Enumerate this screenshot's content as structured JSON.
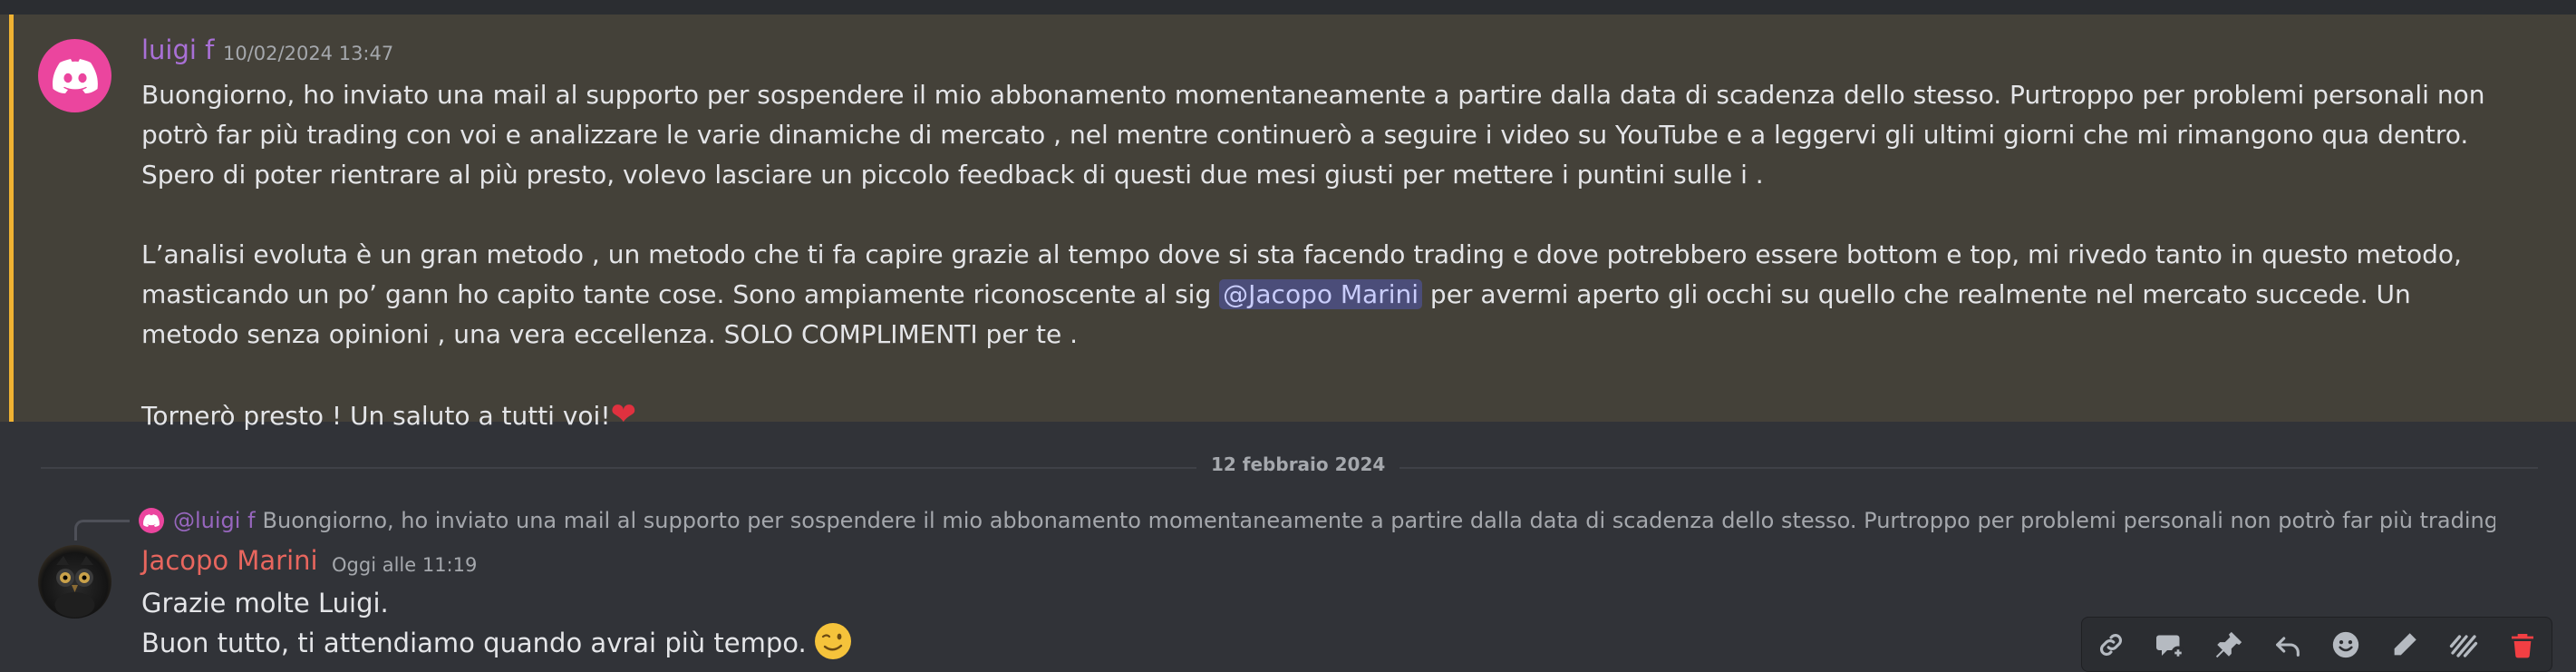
{
  "message1": {
    "author": "luigi f",
    "timestamp": "10/02/2024 13:47",
    "highlight_color": "#f0b232",
    "author_color": "#a970d6",
    "paragraph1": "Buongiorno, ho inviato una mail al supporto per sospendere il mio abbonamento momentaneamente a partire dalla data di scadenza dello stesso. Purtroppo per problemi personali non potrò far più trading con voi e analizzare le varie dinamiche di mercato , nel mentre continuerò a seguire i video su YouTube e a leggervi gli ultimi giorni che mi rimangono qua dentro. Spero di poter rientrare al più presto, volevo lasciare un piccolo feedback di questi due mesi giusti per mettere i puntini sulle i .",
    "paragraph2_before": "L’analisi evoluta è un gran metodo , un metodo che ti fa capire grazie al tempo dove si sta facendo trading e dove potrebbero essere bottom e top, mi rivedo tanto in questo metodo, masticando un po’ gann ho capito tante cose. Sono ampiamente riconoscente al sig ",
    "mention": "@Jacopo Marini",
    "paragraph2_after": " per avermi aperto gli occhi su quello che realmente nel mercato succede. Un metodo senza opinioni , una vera eccellenza. SOLO COMPLIMENTI per te .",
    "paragraph3": "Tornerò presto ! Un saluto a tutti voi!",
    "emoji": "heart"
  },
  "date_divider": "12 febbraio 2024",
  "message2": {
    "reply_author": "@luigi f",
    "reply_preview": "Buongiorno, ho inviato una mail al supporto per sospendere il mio abbonamento momentaneamente a partire dalla data di scadenza dello stesso. Purtroppo per problemi personali non potrò far più trading co",
    "author": "Jacopo Marini",
    "author_color": "#e8665e",
    "timestamp": "Oggi alle 11:19",
    "line1": "Grazie molte Luigi.",
    "line2": "Buon tutto, ti attendiamo quando avrai più tempo.",
    "emoji": "wink"
  },
  "toolbar": {
    "icons": [
      "link-icon",
      "thread-icon",
      "pin-icon",
      "reply-icon",
      "reaction-icon",
      "edit-icon",
      "mark-unread-icon",
      "delete-icon"
    ],
    "delete_color": "#f23f43"
  }
}
